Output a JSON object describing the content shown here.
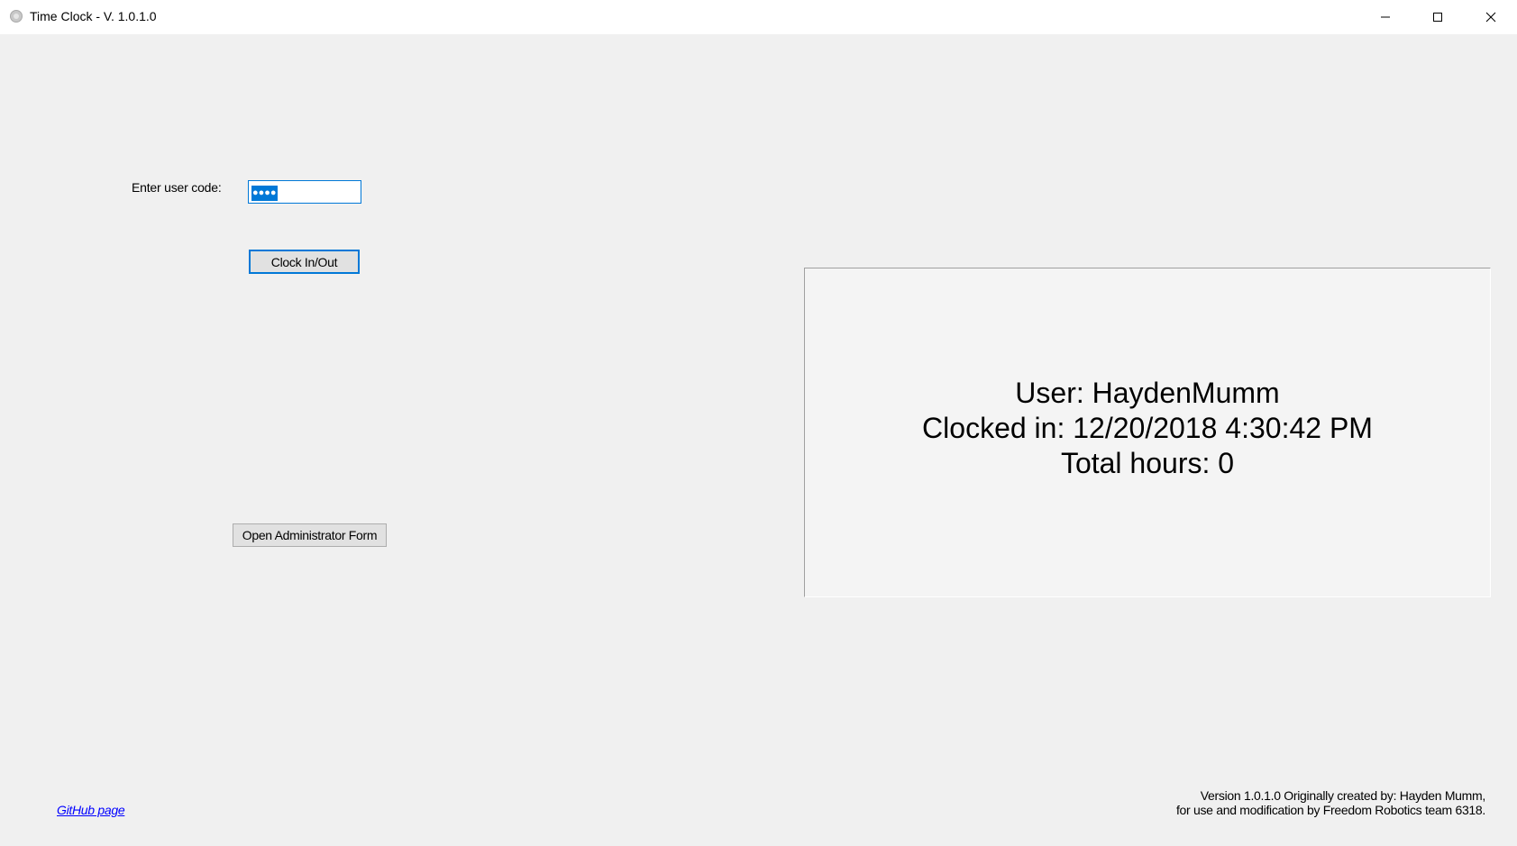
{
  "window": {
    "title": "Time Clock - V. 1.0.1.0",
    "icon": "clock-app-icon",
    "controls": {
      "minimize_icon": "minimize-icon",
      "maximize_icon": "maximize-icon",
      "close_icon": "close-icon"
    }
  },
  "form": {
    "user_code_label": "Enter user code:",
    "user_code_value": "●●●●",
    "clock_button_label": "Clock In/Out",
    "admin_button_label": "Open Administrator Form"
  },
  "status": {
    "user_line": "User: HaydenMumm",
    "clocked_in_line": "Clocked in: 12/20/2018 4:30:42 PM",
    "total_hours_line": "Total hours: 0"
  },
  "footer": {
    "github_link": "GitHub page",
    "version_line1": "Version 1.0.1.0 Originally created by: Hayden Mumm,",
    "version_line2": "for use and modification by Freedom Robotics team 6318."
  },
  "colors": {
    "accent": "#0078d7",
    "window_bg": "#f0f0f0",
    "link": "#0000ff"
  }
}
